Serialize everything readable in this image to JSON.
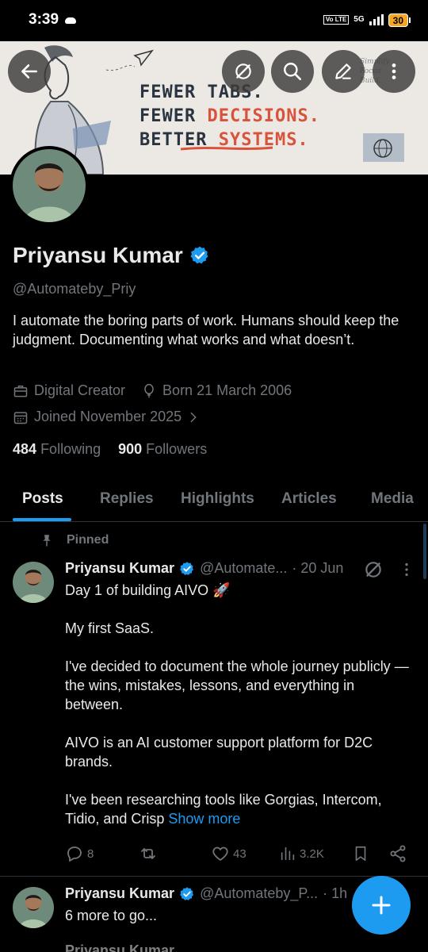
{
  "status_bar": {
    "time": "3:39",
    "network_badge": "Vo LTE",
    "network_type": "5G",
    "battery": "30"
  },
  "banner": {
    "line1": "FEWER TABS.",
    "line2_prefix": "FEWER ",
    "line2_accent": "DECISIONS.",
    "line3_prefix": "BETTER ",
    "line3_accent": "SYSTEMS.",
    "scribble": "Simplify Focus Build.",
    "accent_color": "#d9523a"
  },
  "profile": {
    "name": "Priyansu Kumar",
    "handle": "@Automateby_Priy",
    "bio": "I automate the boring parts of work. Humans should keep the judgment.  Documenting what works and what doesn’t.",
    "category": "Digital Creator",
    "born": "Born 21 March 2006",
    "joined": "Joined November 2025",
    "following_count": "484",
    "following_label": "Following",
    "followers_count": "900",
    "followers_label": "Followers"
  },
  "tabs": [
    "Posts",
    "Replies",
    "Highlights",
    "Articles",
    "Media"
  ],
  "pinned_label": "Pinned",
  "posts": [
    {
      "name": "Priyansu Kumar",
      "handle": "@Automate...",
      "date": "· 20 Jun",
      "paragraphs": [
        "Day 1 of building AIVO 🚀",
        "My first SaaS.",
        "I've decided to document the whole journey publicly — the wins, mistakes, lessons, and everything in between.",
        "AIVO is an AI customer support platform for D2C brands.",
        "I've been researching tools like Gorgias, Intercom, Tidio, and Crisp "
      ],
      "show_more": "Show more",
      "replies": "8",
      "likes": "43",
      "views": "3.2K"
    },
    {
      "name": "Priyansu Kumar",
      "handle": "@Automateby_P...",
      "date": "· 1h",
      "text": "6 more to go..."
    }
  ],
  "third_row": "Priyansu Kumar",
  "colors": {
    "accent_blue": "#1d9bf0",
    "muted": "#71767b",
    "background": "#000000"
  }
}
